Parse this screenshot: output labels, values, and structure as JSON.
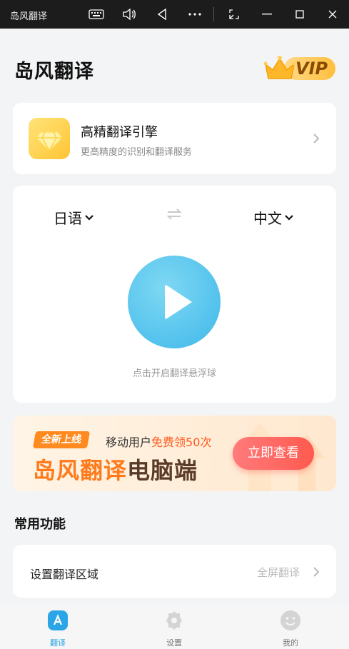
{
  "window": {
    "title": "岛风翻译",
    "buttons": [
      "keyboard-icon",
      "volume-icon",
      "back-icon",
      "more-icon",
      "resize-icon",
      "minimize-icon",
      "maximize-icon",
      "close-icon"
    ]
  },
  "header": {
    "title": "岛风翻译",
    "vip_label": "VIP"
  },
  "engine_card": {
    "title": "高精翻译引擎",
    "subtitle": "更高精度的识别和翻译服务"
  },
  "translate": {
    "source_lang": "日语",
    "target_lang": "中文",
    "hint": "点击开启翻译悬浮球"
  },
  "banner": {
    "tag": "全新上线",
    "line1_prefix": "移动用户",
    "line1_highlight": "免费领50次",
    "big_part1": "岛风翻译",
    "big_part2": "电脑端",
    "button": "立即查看"
  },
  "common": {
    "title": "常用功能",
    "region_label": "设置翻译区域",
    "region_value": "全屏翻译"
  },
  "nav": {
    "items": [
      {
        "label": "翻译",
        "active": true
      },
      {
        "label": "设置",
        "active": false
      },
      {
        "label": "我的",
        "active": false
      }
    ]
  },
  "colors": {
    "accent": "#3fb8ea",
    "vip": "#ffbf3c",
    "banner_orange": "#ff7a1a",
    "nav_active": "#2aa6e6"
  }
}
